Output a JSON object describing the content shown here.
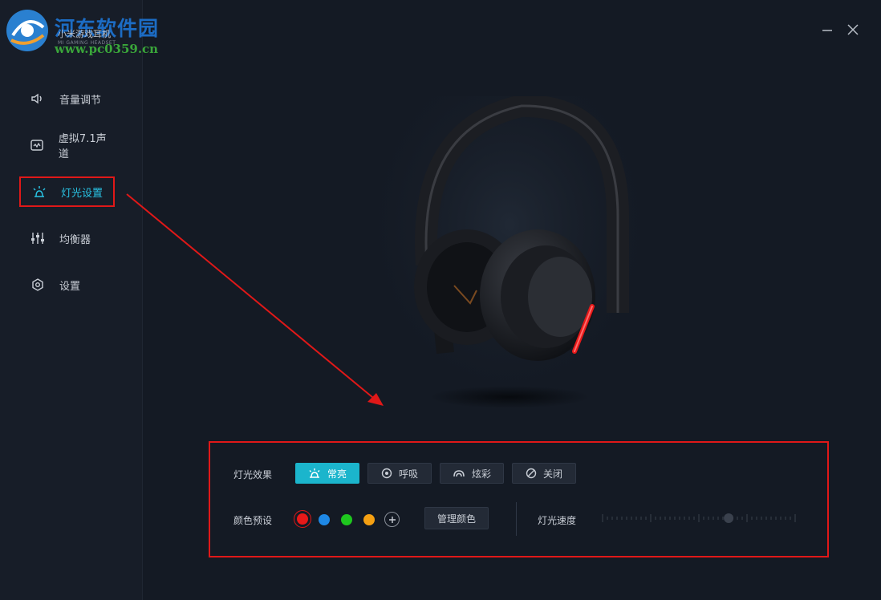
{
  "watermark": {
    "title": "河东软件园",
    "url": "www.pc0359.cn"
  },
  "app": {
    "name": "小米游戏耳机",
    "subtitle": "MI GAMING HEADSET"
  },
  "sidebar": {
    "items": [
      {
        "label": "音量调节",
        "icon": "speaker-icon"
      },
      {
        "label": "虚拟7.1声道",
        "icon": "surround-sound-icon"
      },
      {
        "label": "灯光设置",
        "icon": "light-icon",
        "active": true
      },
      {
        "label": "均衡器",
        "icon": "equalizer-icon"
      },
      {
        "label": "设置",
        "icon": "settings-icon"
      }
    ]
  },
  "window_controls": {
    "minimize": "minimize-icon",
    "close": "close-icon"
  },
  "lighting": {
    "effect_label": "灯光效果",
    "effects": [
      {
        "label": "常亮",
        "icon": "light-icon",
        "active": true
      },
      {
        "label": "呼吸",
        "icon": "breathe-icon"
      },
      {
        "label": "炫彩",
        "icon": "rainbow-icon"
      },
      {
        "label": "关闭",
        "icon": "off-icon"
      }
    ],
    "color_label": "颜色预设",
    "colors": [
      "#e81919",
      "#1e88e5",
      "#1ec71e",
      "#f5a012"
    ],
    "selected_color": "#e81919",
    "manage_label": "管理颜色",
    "speed_label": "灯光速度",
    "speed_value": 0.66
  },
  "colors": {
    "accent": "#1bb5cc",
    "annotation": "#e01818"
  }
}
